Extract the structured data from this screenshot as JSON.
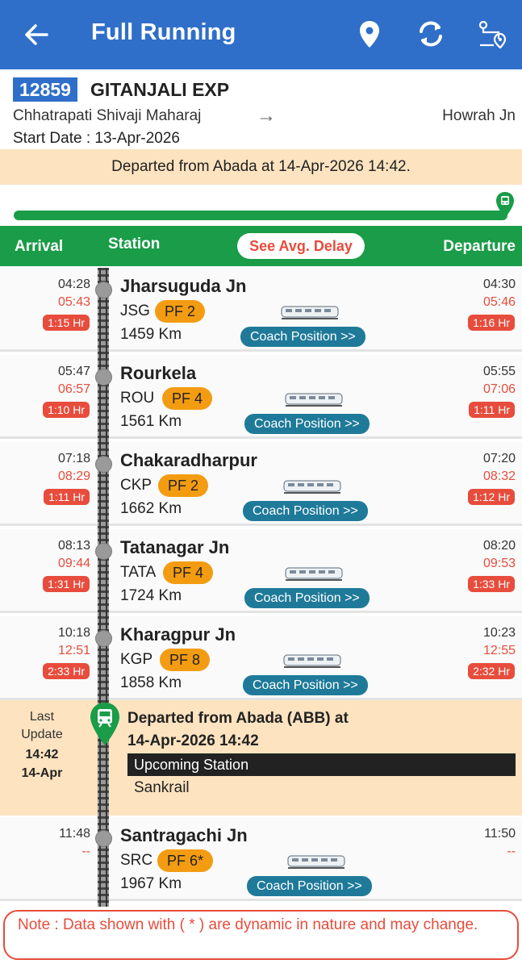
{
  "app": {
    "title": "Full Running",
    "icons": [
      "back-arrow-icon",
      "location-pin-icon",
      "refresh-icon",
      "route-icon"
    ],
    "colors": {
      "appbar": "#2f6fc9",
      "green": "#1a9c48",
      "late": "#e74c3c",
      "platform": "#f39c12",
      "coach": "#1f7a99",
      "highlight": "#fde3c0"
    }
  },
  "train": {
    "number": "12859",
    "name": "GITANJALI EXP",
    "from": "Chhatrapati Shivaji Maharaj",
    "arrow": "→",
    "to": "Howrah Jn",
    "start_date": "Start Date : 13-Apr-2026"
  },
  "status": "Departed from Abada at 14-Apr-2026 14:42.",
  "progress_fraction": 1.0,
  "table_header": {
    "arrival": "Arrival",
    "station": "Station",
    "avg_delay_button": "See Avg. Delay",
    "departure": "Departure"
  },
  "stations": [
    {
      "sched_arr": "04:28",
      "actual_arr": "05:43",
      "delay_arr": "1:15 Hr",
      "name": "Jharsuguda Jn",
      "code": "JSG",
      "pf": "PF 2",
      "km": "1459 Km",
      "coach": "Coach Position >>",
      "sched_dep": "04:30",
      "actual_dep": "05:46",
      "delay_dep": "1:16 Hr"
    },
    {
      "sched_arr": "05:47",
      "actual_arr": "06:57",
      "delay_arr": "1:10 Hr",
      "name": "Rourkela",
      "code": "ROU",
      "pf": "PF 4",
      "km": "1561 Km",
      "coach": "Coach Position >>",
      "sched_dep": "05:55",
      "actual_dep": "07:06",
      "delay_dep": "1:11 Hr"
    },
    {
      "sched_arr": "07:18",
      "actual_arr": "08:29",
      "delay_arr": "1:11 Hr",
      "name": "Chakaradharpur",
      "code": "CKP",
      "pf": "PF 2",
      "km": "1662 Km",
      "coach": "Coach Position >>",
      "sched_dep": "07:20",
      "actual_dep": "08:32",
      "delay_dep": "1:12 Hr"
    },
    {
      "sched_arr": "08:13",
      "actual_arr": "09:44",
      "delay_arr": "1:31 Hr",
      "name": "Tatanagar Jn",
      "code": "TATA",
      "pf": "PF 4",
      "km": "1724 Km",
      "coach": "Coach Position >>",
      "sched_dep": "08:20",
      "actual_dep": "09:53",
      "delay_dep": "1:33 Hr"
    },
    {
      "sched_arr": "10:18",
      "actual_arr": "12:51",
      "delay_arr": "2:33 Hr",
      "name": "Kharagpur Jn",
      "code": "KGP",
      "pf": "PF 8",
      "km": "1858 Km",
      "coach": "Coach Position >>",
      "sched_dep": "10:23",
      "actual_dep": "12:55",
      "delay_dep": "2:32 Hr"
    },
    {
      "sched_arr": "11:48",
      "actual_arr": "--",
      "name": "Santragachi Jn",
      "code": "SRC",
      "pf": "PF 6*",
      "km": "1967 Km",
      "coach": "Coach Position >>",
      "sched_dep": "11:50",
      "actual_dep": "--"
    }
  ],
  "current": {
    "last_update_label1": "Last",
    "last_update_label2": "Update",
    "time": "14:42",
    "date": "14-Apr",
    "message_line1": "Departed from Abada (ABB) at",
    "message_line2": "14-Apr-2026 14:42",
    "upcoming_label": "Upcoming Station",
    "upcoming_station": "Sankrail"
  },
  "note": "Note : Data shown with ( * ) are dynamic in nature and may change."
}
